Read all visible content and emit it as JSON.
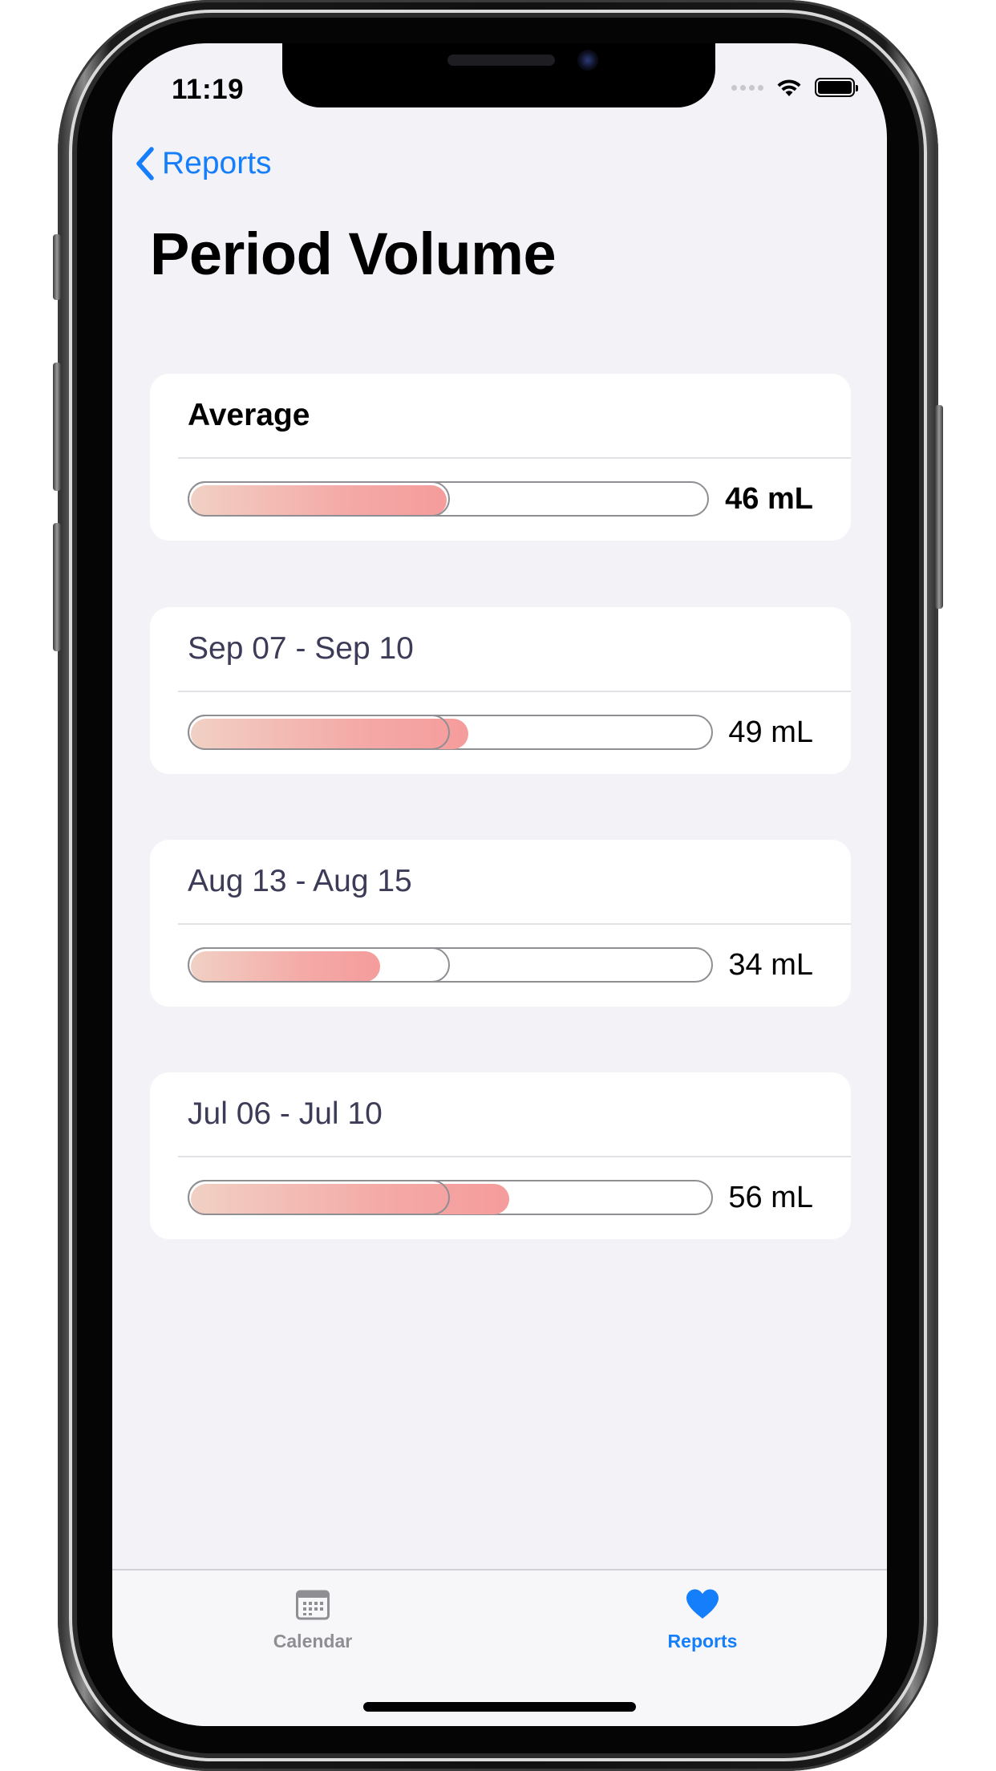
{
  "status_bar": {
    "time": "11:19"
  },
  "nav": {
    "back_label": "Reports",
    "title": "Period Volume"
  },
  "accent_color": "#157efb",
  "average": {
    "label": "Average",
    "value_label": "46 mL",
    "value_ml": 46
  },
  "cycles": [
    {
      "range": "Sep 07 - Sep 10",
      "value_label": "49 mL",
      "value_ml": 49
    },
    {
      "range": "Aug 13 - Aug 15",
      "value_label": "34 mL",
      "value_ml": 34
    },
    {
      "range": "Jul 06 - Jul 10",
      "value_label": "56 mL",
      "value_ml": 56
    }
  ],
  "tabs": [
    {
      "label": "Calendar",
      "icon": "calendar-icon",
      "active": false
    },
    {
      "label": "Reports",
      "icon": "heart-icon",
      "active": true
    }
  ]
}
